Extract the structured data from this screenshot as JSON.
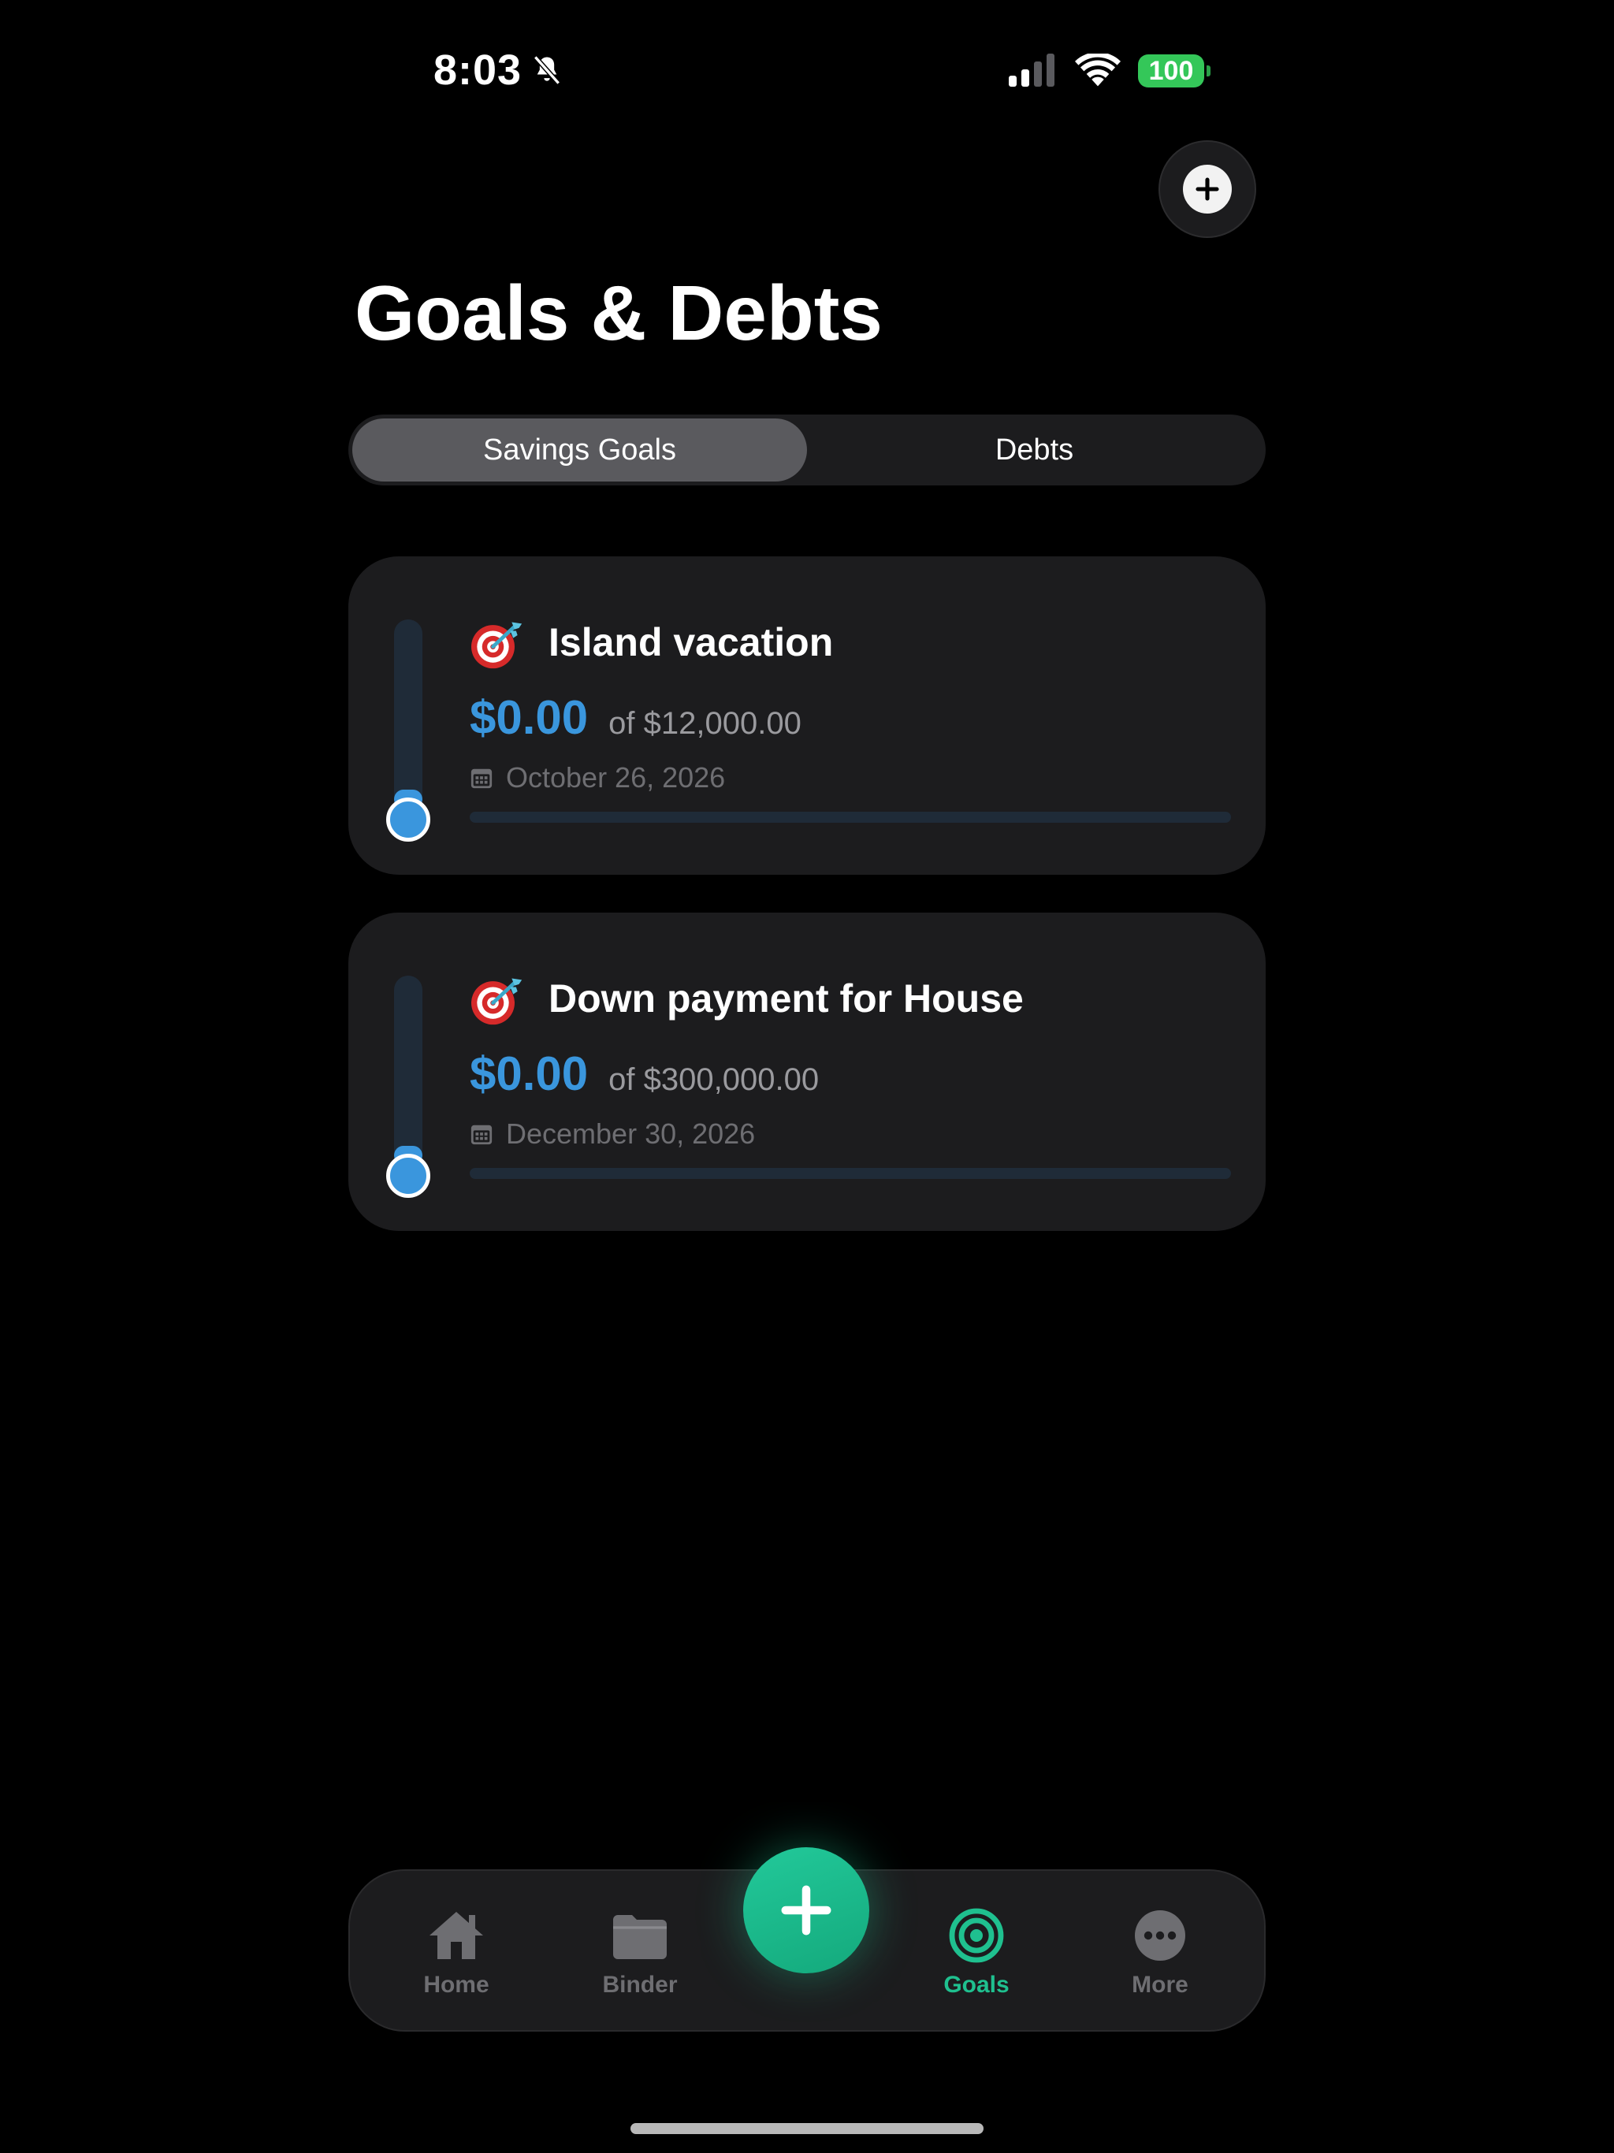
{
  "status_bar": {
    "time": "8:03",
    "battery": "100"
  },
  "header": {
    "title": "Goals & Debts"
  },
  "segments": {
    "savings_label": "Savings Goals",
    "debts_label": "Debts",
    "selected": "Savings Goals"
  },
  "goals": [
    {
      "name": "Island vacation",
      "saved": "$0.00",
      "target": "of $12,000.00",
      "date": "October 26, 2026",
      "progress": 0
    },
    {
      "name": "Down payment for House",
      "saved": "$0.00",
      "target": "of $300,000.00",
      "date": "December 30, 2026",
      "progress": 0
    }
  ],
  "tab_bar": {
    "items": [
      {
        "label": "Home",
        "icon": "house-icon",
        "active": false
      },
      {
        "label": "Binder",
        "icon": "folder-icon",
        "active": false
      },
      {
        "label": "Goals",
        "icon": "target-icon",
        "active": true
      },
      {
        "label": "More",
        "icon": "ellipsis-icon",
        "active": false
      }
    ]
  },
  "colors": {
    "accent_blue": "#3a96dd",
    "accent_green": "#1fc08f",
    "battery_green": "#34c759",
    "card_bg": "#1c1c1e"
  }
}
